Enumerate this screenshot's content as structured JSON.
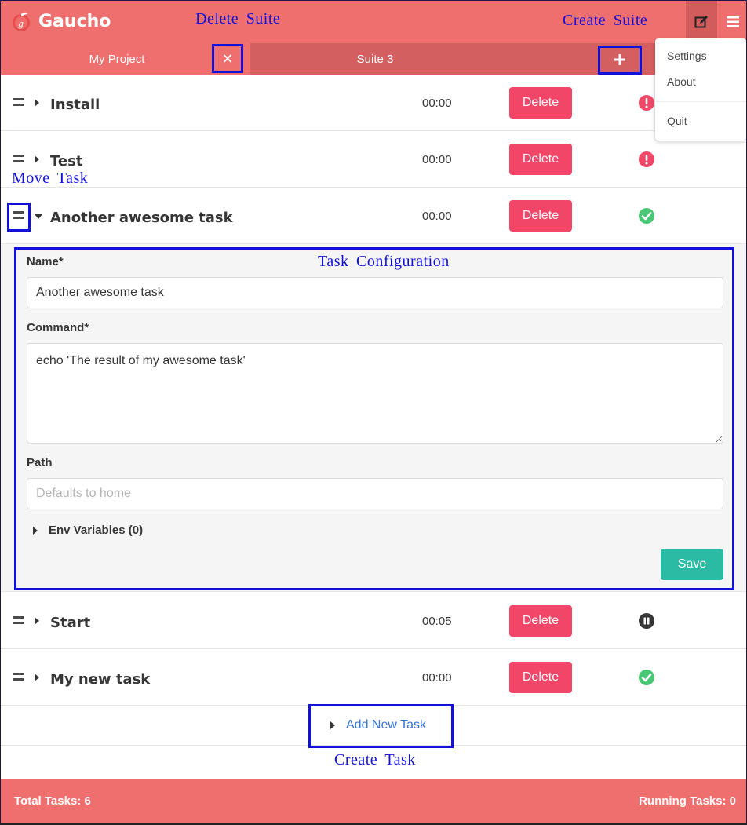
{
  "app": {
    "name": "Gaucho",
    "accent_color": "#ef6f6f",
    "header_icons": [
      "gaucho-logo",
      "edit-icon",
      "hamburger-menu-icon"
    ]
  },
  "tabs": [
    {
      "label": "My Project",
      "active": true
    },
    {
      "label": "Suite 3",
      "active": false
    }
  ],
  "menu": {
    "items": [
      {
        "label": "Settings"
      },
      {
        "label": "About"
      },
      {
        "label": "Quit"
      }
    ]
  },
  "tasks": [
    {
      "name": "Install",
      "time": "00:00",
      "delete_label": "Delete",
      "status": "error",
      "expanded": false
    },
    {
      "name": "Test",
      "time": "00:00",
      "delete_label": "Delete",
      "status": "error",
      "expanded": false
    },
    {
      "name": "Another awesome task",
      "time": "00:00",
      "delete_label": "Delete",
      "status": "success",
      "expanded": true
    },
    {
      "name": "Start",
      "time": "00:05",
      "delete_label": "Delete",
      "status": "paused",
      "expanded": false
    },
    {
      "name": "My new task",
      "time": "00:00",
      "delete_label": "Delete",
      "status": "success",
      "expanded": false
    }
  ],
  "config": {
    "name_label": "Name*",
    "name_value": "Another awesome task",
    "command_label": "Command*",
    "command_value": "echo 'The result of my awesome task'",
    "path_label": "Path",
    "path_placeholder": "Defaults to home",
    "env_label": "Env Variables (0)",
    "save_label": "Save"
  },
  "add_task_label": "Add New Task",
  "footer": {
    "total": "Total Tasks: 6",
    "running": "Running Tasks: 0"
  },
  "annotations": {
    "delete_suite": "Delete Suite",
    "create_suite": "Create Suite",
    "move_task": "Move Task",
    "task_configuration": "Task Configuration",
    "create_task": "Create Task"
  },
  "status_colors": {
    "error": "#f14668",
    "success": "#48c774",
    "paused": "#363636"
  }
}
